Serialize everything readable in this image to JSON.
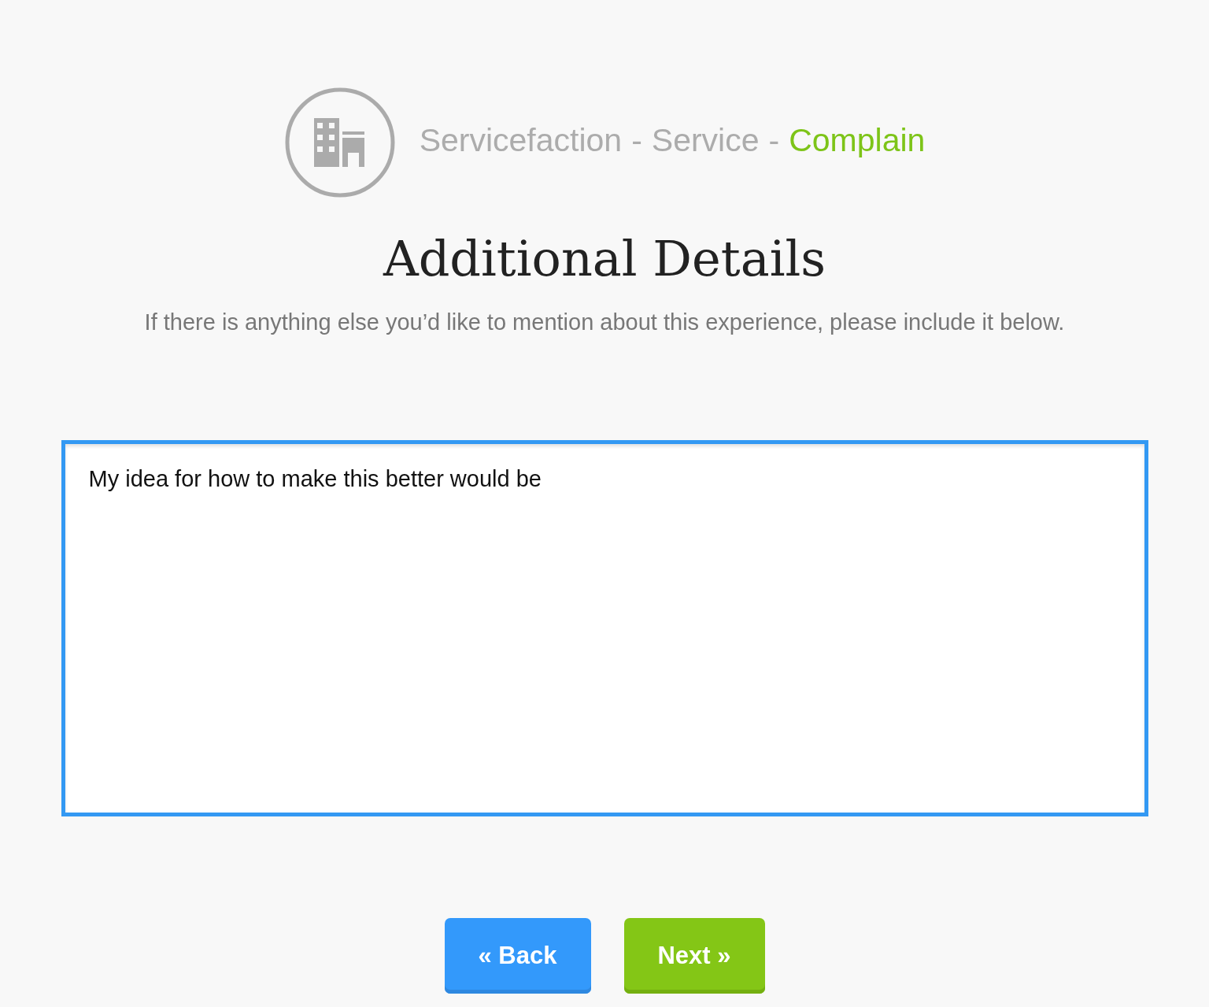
{
  "breadcrumb": {
    "items": [
      {
        "label": "Servicefaction",
        "selected": false
      },
      {
        "label": "Service",
        "selected": false
      },
      {
        "label": "Complain",
        "selected": true
      }
    ],
    "separator": "-"
  },
  "heading": "Additional Details",
  "subtitle": "If there is anything else you’d like to mention about this experience, please include it below.",
  "details_field": {
    "value": "My idea for how to make this better would be",
    "focused": true
  },
  "buttons": [
    {
      "label": "« Back",
      "kind": "back"
    },
    {
      "label": "Next »",
      "kind": "next"
    }
  ]
}
